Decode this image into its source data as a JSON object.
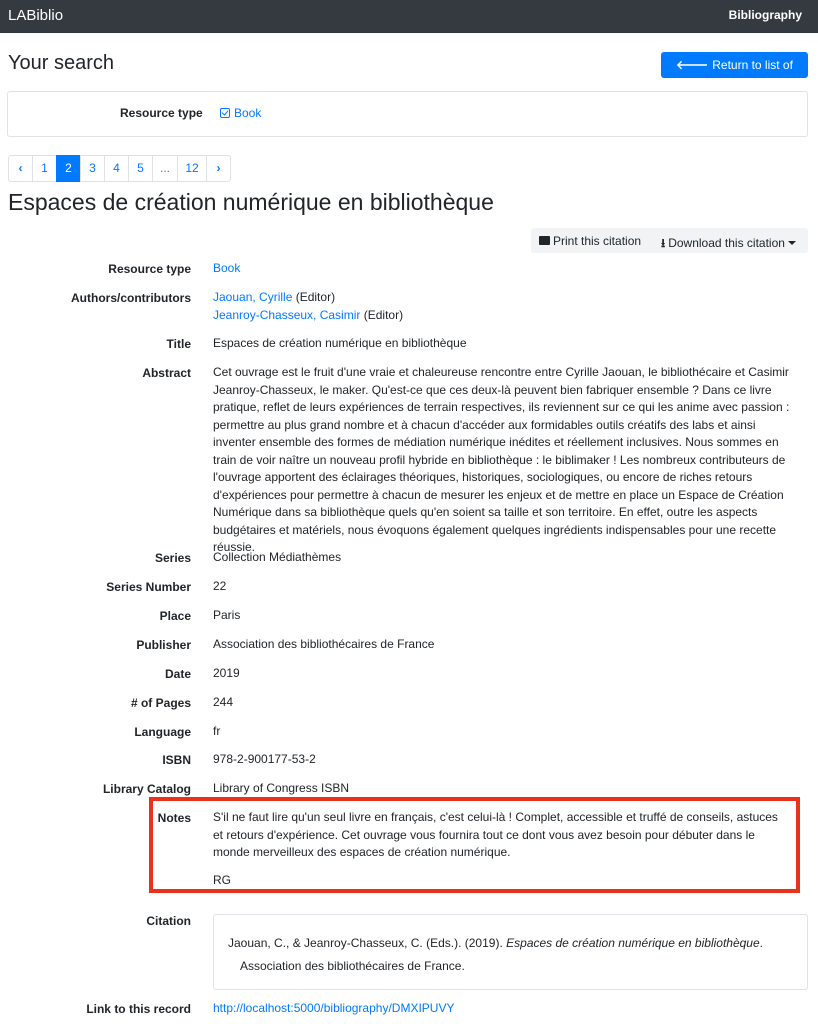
{
  "navbar": {
    "brand": "LABiblio",
    "link": "Bibliography"
  },
  "search": {
    "title": "Your search",
    "return_button": "Return to list of results",
    "resource_type_label": "Resource type",
    "resource_type_value": "Book"
  },
  "pagination": {
    "prev": "‹",
    "pages": [
      "1",
      "2",
      "3",
      "4",
      "5",
      "...",
      "12"
    ],
    "active": "2",
    "next": "›"
  },
  "record": {
    "title": "Espaces de création numérique en bibliothèque",
    "print_button": "Print this citation",
    "download_button": "Download this citation",
    "fields": {
      "resource_type": {
        "label": "Resource type",
        "value": "Book"
      },
      "authors": {
        "label": "Authors/contributors",
        "items": [
          {
            "name": "Jaouan, Cyrille",
            "role": "(Editor)"
          },
          {
            "name": "Jeanroy-Chasseux, Casimir",
            "role": "(Editor)"
          }
        ]
      },
      "title": {
        "label": "Title",
        "value": "Espaces de création numérique en bibliothèque"
      },
      "abstract": {
        "label": "Abstract",
        "value": "Cet ouvrage est le fruit d'une vraie et chaleureuse rencontre entre Cyrille Jaouan, le bibliothécaire et Casimir Jeanroy-Chasseux, le maker. Qu'est-ce que ces deux-là peuvent bien fabriquer ensemble ? Dans ce livre pratique, reflet de leurs expériences de terrain respectives, ils reviennent sur ce qui les anime avec passion : permettre au plus grand nombre et à chacun d'accéder aux formidables outils créatifs des labs et ainsi inventer ensemble des formes de médiation numérique inédites et réellement inclusives. Nous sommes en train de voir naître un nouveau profil hybride en bibliothèque : le biblimaker ! Les nombreux contributeurs de l'ouvrage apportent des éclairages théoriques, historiques, sociologiques, ou encore de riches retours d'expériences pour permettre à chacun de mesurer les enjeux et de mettre en place un Espace de Création Numérique dans sa bibliothèque quels qu'en soient sa taille et son territoire. En effet, outre les aspects budgétaires et matériels, nous évoquons également quelques ingrédients indispensables pour une recette réussie."
      },
      "series": {
        "label": "Series",
        "value": "Collection Médiathèmes"
      },
      "series_number": {
        "label": "Series Number",
        "value": "22"
      },
      "place": {
        "label": "Place",
        "value": "Paris"
      },
      "publisher": {
        "label": "Publisher",
        "value": "Association des bibliothécaires de France"
      },
      "date": {
        "label": "Date",
        "value": "2019"
      },
      "pages": {
        "label": "# of Pages",
        "value": "244"
      },
      "language": {
        "label": "Language",
        "value": "fr"
      },
      "isbn": {
        "label": "ISBN",
        "value": "978-2-900177-53-2"
      },
      "library_catalog": {
        "label": "Library Catalog",
        "value": "Library of Congress ISBN"
      },
      "notes": {
        "label": "Notes",
        "value": "S'il ne faut lire qu'un seul livre en français, c'est celui-là ! Complet, accessible et truffé de conseils, astuces et retours d'expérience. Cet ouvrage vous fournira tout ce dont vous avez besoin pour débuter dans le monde merveilleux des espaces de création numérique.",
        "signature": "RG"
      },
      "citation": {
        "label": "Citation",
        "authors": "Jaouan, C., & Jeanroy-Chasseux, C. (Eds.). (2019).",
        "book_title": "Espaces de création numérique en bibliothèque",
        "period": ".",
        "publisher": "Association des bibliothécaires de France."
      },
      "link": {
        "label": "Link to this record",
        "value": "http://localhost:5000/bibliography/DMXIPUVY"
      }
    }
  },
  "colors": {
    "navbar": "#343a40",
    "primary": "#007bff",
    "highlight": "#e8321b"
  }
}
